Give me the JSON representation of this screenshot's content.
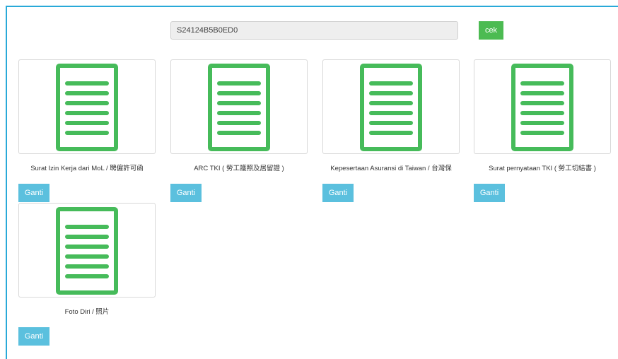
{
  "search": {
    "code_value": "S24124B5B0ED0"
  },
  "actions": {
    "check_label": "cek"
  },
  "documents": [
    {
      "caption": "Surat Izin Kerja dari MoL / 聘僱許可函",
      "button_label": "Ganti",
      "icon": "document-icon"
    },
    {
      "caption": "ARC TKI ( 勞工護照及居留證 )",
      "button_label": "Ganti",
      "icon": "document-icon"
    },
    {
      "caption": "Kepesertaan Asuransi di Taiwan / 台灣保",
      "button_label": "Ganti",
      "icon": "document-icon"
    },
    {
      "caption": "Surat pernyataan TKI ( 勞工切結書 )",
      "button_label": "Ganti",
      "icon": "document-icon"
    },
    {
      "caption": "Foto Diri / 照片",
      "button_label": "Ganti",
      "icon": "document-icon"
    }
  ],
  "colors": {
    "frame_border": "#29a9d8",
    "check_button": "#4cbb52",
    "replace_button": "#5bc0de",
    "document_icon": "#46bb5a"
  }
}
